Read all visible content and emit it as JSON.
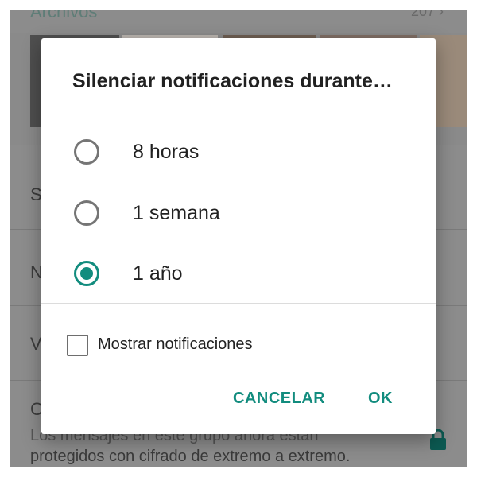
{
  "background": {
    "files_title": "Archivos",
    "files_count": "207 ›",
    "row_letters": [
      "S",
      "N",
      "V",
      "C"
    ],
    "encryption_line1": "Los mensajes en este grupo ahora están",
    "encryption_line2": "protegidos con cifrado de extremo a extremo.",
    "lock_icon": "lock-icon"
  },
  "dialog": {
    "title": "Silenciar notificaciones durante…",
    "options": [
      {
        "label": "8 horas",
        "selected": false
      },
      {
        "label": "1 semana",
        "selected": false
      },
      {
        "label": "1 año",
        "selected": true
      }
    ],
    "show_notifications_label": "Mostrar notificaciones",
    "show_notifications_checked": false,
    "cancel_label": "CANCELAR",
    "ok_label": "OK"
  },
  "colors": {
    "accent": "#128c7e",
    "overlay": "#8a8a8a"
  }
}
